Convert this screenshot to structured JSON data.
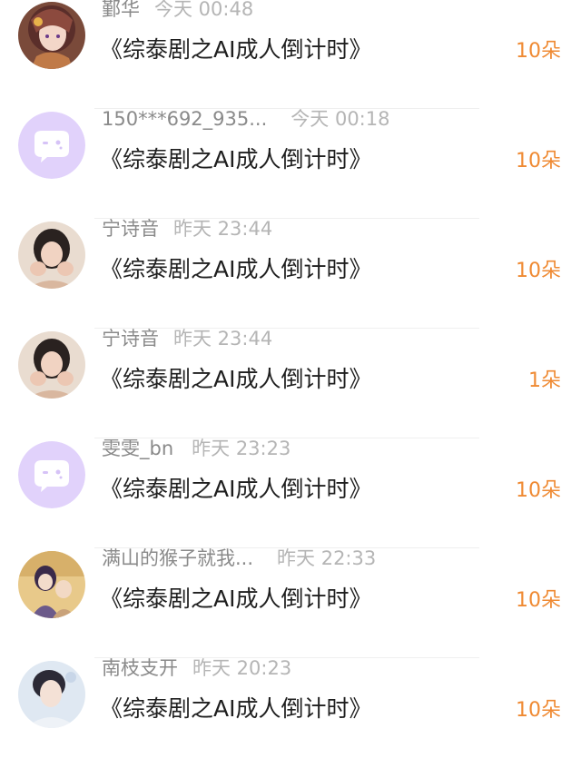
{
  "items": [
    {
      "name": "鄞华",
      "time": "今天 00:48",
      "title": "《综泰剧之AI成人倒计时》",
      "amount": "10朵",
      "avatar": "anime-girl-avatar"
    },
    {
      "name": "150***692_935...",
      "time": "今天 00:18",
      "title": "《综泰剧之AI成人倒计时》",
      "amount": "10朵",
      "avatar": "default-chat-avatar"
    },
    {
      "name": "宁诗音",
      "time": "昨天 23:44",
      "title": "《综泰剧之AI成人倒计时》",
      "amount": "10朵",
      "avatar": "girl-photo-avatar"
    },
    {
      "name": "宁诗音",
      "time": "昨天 23:44",
      "title": "《综泰剧之AI成人倒计时》",
      "amount": "1朵",
      "avatar": "girl-photo-avatar"
    },
    {
      "name": "雯雯_bn",
      "time": "昨天 23:23",
      "title": "《综泰剧之AI成人倒计时》",
      "amount": "10朵",
      "avatar": "default-chat-avatar"
    },
    {
      "name": "满山的猴子就我...",
      "time": "昨天 22:33",
      "title": "《综泰剧之AI成人倒计时》",
      "amount": "10朵",
      "avatar": "illustrated-couple-avatar"
    },
    {
      "name": "南枝支开",
      "time": "昨天 20:23",
      "title": "《综泰剧之AI成人倒计时》",
      "amount": "10朵",
      "avatar": "man-portrait-avatar"
    }
  ],
  "colors": {
    "amount": "#ef8a33",
    "name": "#8a8a8a",
    "time": "#b5b5b5",
    "default_avatar_bg": "#e1d2fb"
  }
}
